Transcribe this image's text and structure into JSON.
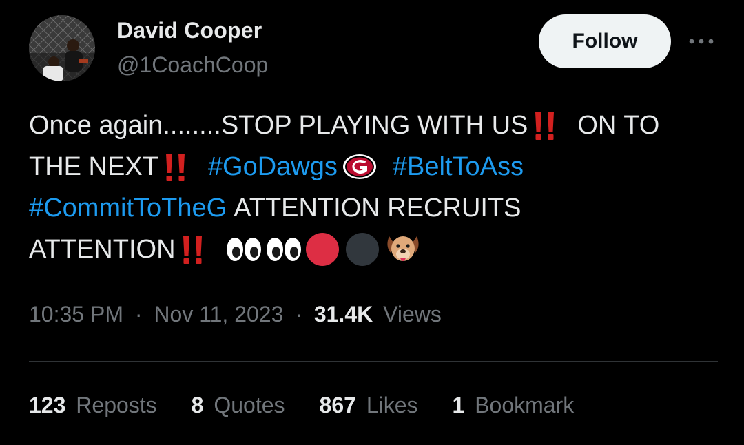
{
  "author": {
    "name": "David Cooper",
    "handle": "@1CoachCoop",
    "avatar_icon": "profile-photo"
  },
  "actions": {
    "follow_label": "Follow",
    "more_icon": "more-horizontal-icon"
  },
  "tweet": {
    "line1_text": "Once again........STOP PLAYING WITH US",
    "line1_after": "ON TO",
    "line2_text": "THE NEXT",
    "hashtag_godawgs": "#GoDawgs",
    "hashtag_belttoass": "#BeltToAss",
    "hashtag_committotheg": "#CommitToTheG",
    "line3_text": "ATTENTION RECRUITS",
    "line4_text": "ATTENTION",
    "emojis": [
      "double-exclamation",
      "georgia-g-logo",
      "eyes",
      "eyes",
      "red-circle",
      "black-circle",
      "dog-face"
    ]
  },
  "meta": {
    "time": "10:35 PM",
    "separator": "·",
    "date": "Nov 11, 2023",
    "views_count": "31.4K",
    "views_label": "Views"
  },
  "stats": {
    "reposts_count": "123",
    "reposts_label": "Reposts",
    "quotes_count": "8",
    "quotes_label": "Quotes",
    "likes_count": "867",
    "likes_label": "Likes",
    "bookmarks_count": "1",
    "bookmarks_label": "Bookmark"
  },
  "colors": {
    "background": "#000000",
    "text_primary": "#e7e9ea",
    "text_secondary": "#71767b",
    "link": "#1d9bf0",
    "follow_bg": "#eff3f4",
    "divider": "#2f3336",
    "bang_red": "#d2201f"
  }
}
